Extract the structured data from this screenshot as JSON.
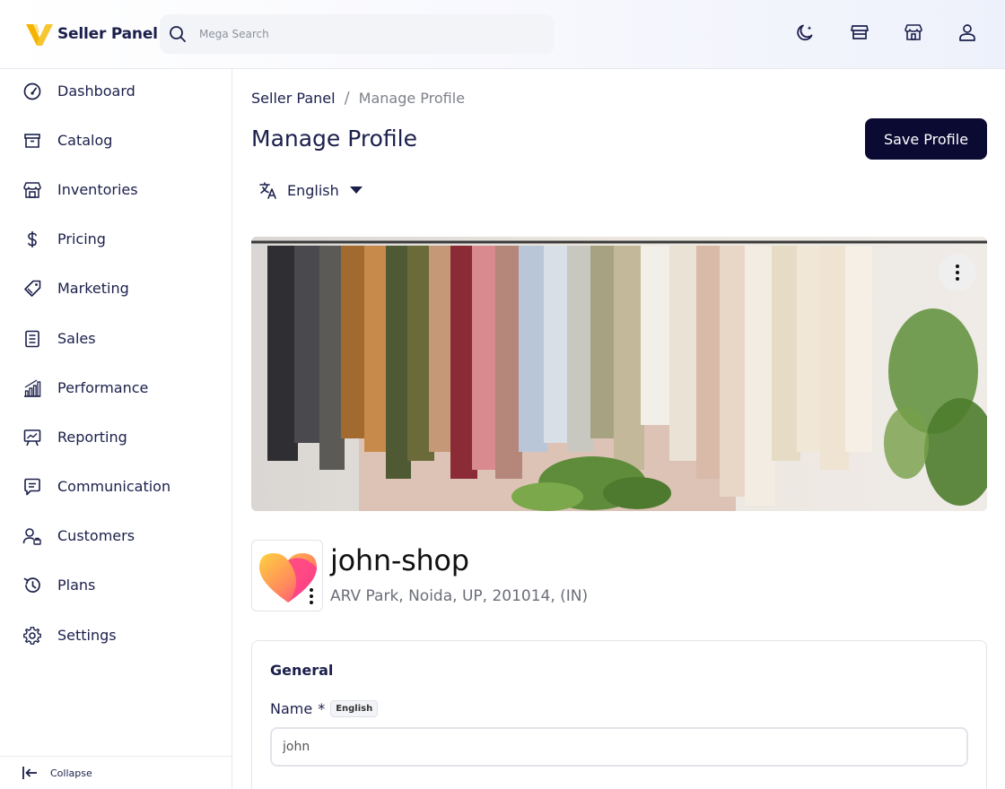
{
  "header": {
    "brand_name": "Seller Panel",
    "search_placeholder": "Mega Search",
    "icons": [
      "moon-icon",
      "storefront-icon",
      "store-building-icon",
      "user-icon"
    ]
  },
  "sidebar": {
    "items": [
      {
        "label": "Dashboard",
        "icon": "dashboard-gauge-icon"
      },
      {
        "label": "Catalog",
        "icon": "archive-box-icon"
      },
      {
        "label": "Inventories",
        "icon": "warehouse-icon"
      },
      {
        "label": "Pricing",
        "icon": "dollar-icon"
      },
      {
        "label": "Marketing",
        "icon": "price-tag-icon"
      },
      {
        "label": "Sales",
        "icon": "document-list-icon"
      },
      {
        "label": "Performance",
        "icon": "bar-chart-icon"
      },
      {
        "label": "Reporting",
        "icon": "presentation-board-icon"
      },
      {
        "label": "Communication",
        "icon": "chat-bubble-icon"
      },
      {
        "label": "Customers",
        "icon": "customers-icon"
      },
      {
        "label": "Plans",
        "icon": "history-icon"
      },
      {
        "label": "Settings",
        "icon": "gear-icon"
      }
    ],
    "collapse_label": "Collapse"
  },
  "breadcrumb": {
    "root": "Seller Panel",
    "separator": "/",
    "current": "Manage Profile"
  },
  "page": {
    "title": "Manage Profile",
    "save_label": "Save Profile",
    "language": "English"
  },
  "shop": {
    "name": "john-shop",
    "address": "ARV Park, Noida, UP, 201014, (IN)"
  },
  "general": {
    "title": "General",
    "name_label": "Name",
    "required_mark": "*",
    "language_badge": "English",
    "name_value": "john"
  },
  "colors": {
    "primary_button": "#0b0a33",
    "text_dark": "#1b1f4b",
    "text_muted": "#7e818a"
  }
}
